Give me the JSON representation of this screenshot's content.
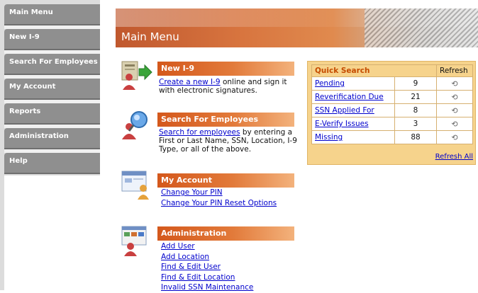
{
  "sidebar": {
    "items": [
      {
        "label": "Main Menu"
      },
      {
        "label": "New I-9"
      },
      {
        "label": "Search For Employees"
      },
      {
        "label": "My Account"
      },
      {
        "label": "Reports"
      },
      {
        "label": "Administration"
      },
      {
        "label": "Help"
      }
    ]
  },
  "header": {
    "title": "Main Menu"
  },
  "sections": {
    "new_i9": {
      "title": "New I-9",
      "link": "Create a new I-9",
      "text": " online and sign it with electronic signatures."
    },
    "search": {
      "title": "Search For Employees",
      "link": "Search for employees",
      "text": " by entering a First or Last Name, SSN, Location, I-9 Type, or all of the above."
    },
    "account": {
      "title": "My Account",
      "links": [
        "Change Your PIN",
        "Change Your PIN Reset Options"
      ]
    },
    "admin": {
      "title": "Administration",
      "links": [
        "Add User",
        "Add Location",
        "Find & Edit User",
        "Find & Edit Location",
        "Invalid SSN Maintenance"
      ]
    }
  },
  "quick_search": {
    "title": "Quick Search",
    "refresh_header": "Refresh",
    "refresh_all": "Refresh All",
    "rows": [
      {
        "label": "Pending",
        "count": "9"
      },
      {
        "label": "Reverification Due",
        "count": "21"
      },
      {
        "label": "SSN Applied For",
        "count": "8"
      },
      {
        "label": "E-Verify Issues",
        "count": "3"
      },
      {
        "label": "Missing",
        "count": "88"
      }
    ]
  },
  "colors": {
    "accent": "#d4581c",
    "sidebar_button": "#8f8f8f",
    "quick_search_bg": "#f6d38c",
    "link": "#0000cc"
  }
}
